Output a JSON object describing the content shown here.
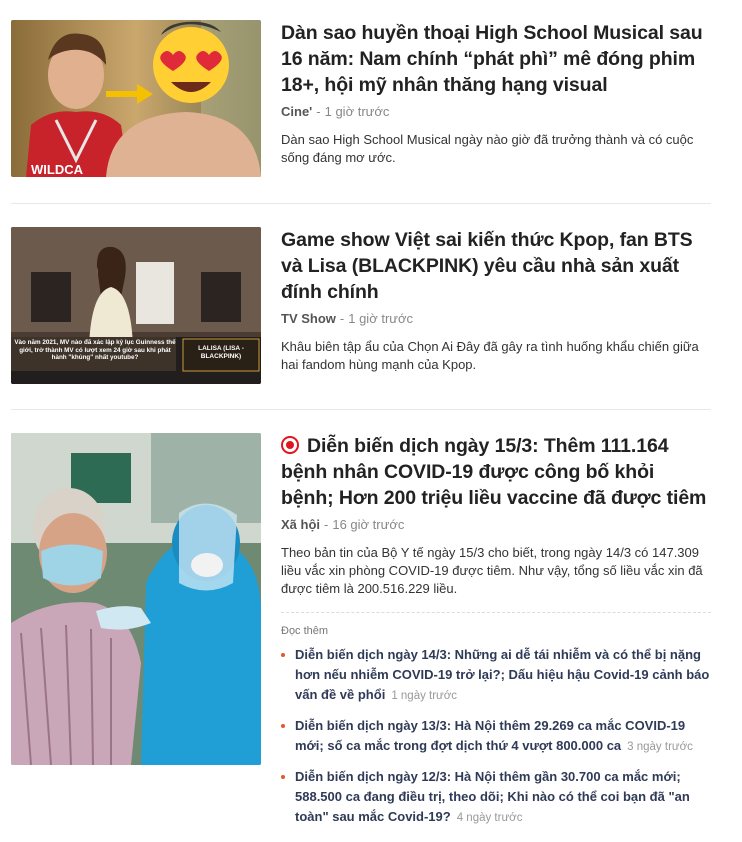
{
  "articles": [
    {
      "title": "Dàn sao huyền thoại High School Musical sau 16 năm: Nam chính “phát phì” mê đóng phim 18+, hội mỹ nhân thăng hạng visual",
      "category": "Cine'",
      "time": "1 giờ trước",
      "sapo": "Dàn sao High School Musical ngày nào giờ đã trưởng thành và có cuộc sống đáng mơ ước.",
      "thumb_text": "WILDCA"
    },
    {
      "title": "Game show Việt sai kiến thức Kpop, fan BTS và Lisa (BLACKPINK) yêu cầu nhà sản xuất đính chính",
      "category": "TV Show",
      "time": "1 giờ trước",
      "sapo": "Khâu biên tập ẩu của Chọn Ai Đây đã gây ra tình huống khẩu chiến giữa hai fandom hùng mạnh của Kpop.",
      "thumb_caption": "Vào năm 2021, MV nào đã xác lập kỷ lục Guinness thế giới, trở thành MV có lượt xem 24 giờ sau khi phát hành \"khủng\" nhất youtube?",
      "thumb_badge": "LALISA (LISA - BLACKPINK)"
    },
    {
      "title": "Diễn biến dịch ngày 15/3: Thêm 111.164 bệnh nhân COVID-19 được công bố khỏi bệnh; Hơn 200 triệu liều vaccine đã được tiêm",
      "category": "Xã hội",
      "time": "16 giờ trước",
      "sapo": "Theo bản tin của Bộ Y tế ngày 15/3 cho biết, trong ngày 14/3 có 147.309 liều vắc xin phòng COVID-19 được tiêm. Như vậy, tổng số liều vắc xin đã được tiêm là 200.516.229 liều.",
      "related_label": "Đọc thêm",
      "related": [
        {
          "title": "Diễn biến dịch ngày 14/3: Những ai dễ tái nhiễm và có thể bị nặng hơn nếu nhiễm COVID-19 trở lại?; Dấu hiệu hậu Covid-19 cảnh báo vấn đề về phổi",
          "time": "1 ngày trước"
        },
        {
          "title": "Diễn biến dịch ngày 13/3: Hà Nội thêm 29.269 ca mắc COVID-19 mới; số ca mắc trong đợt dịch thứ 4 vượt 800.000 ca",
          "time": "3 ngày trước"
        },
        {
          "title": "Diễn biến dịch ngày 12/3: Hà Nội thêm gần 30.700 ca mắc mới; 588.500 ca đang điều trị, theo dõi; Khi nào có thể coi bạn đã \"an toàn\" sau mắc Covid-19?",
          "time": "4 ngày trước"
        }
      ]
    }
  ],
  "colors": {
    "accent_red": "#e0151f",
    "bullet": "#e05a2b",
    "related_link": "#2f3a57"
  }
}
